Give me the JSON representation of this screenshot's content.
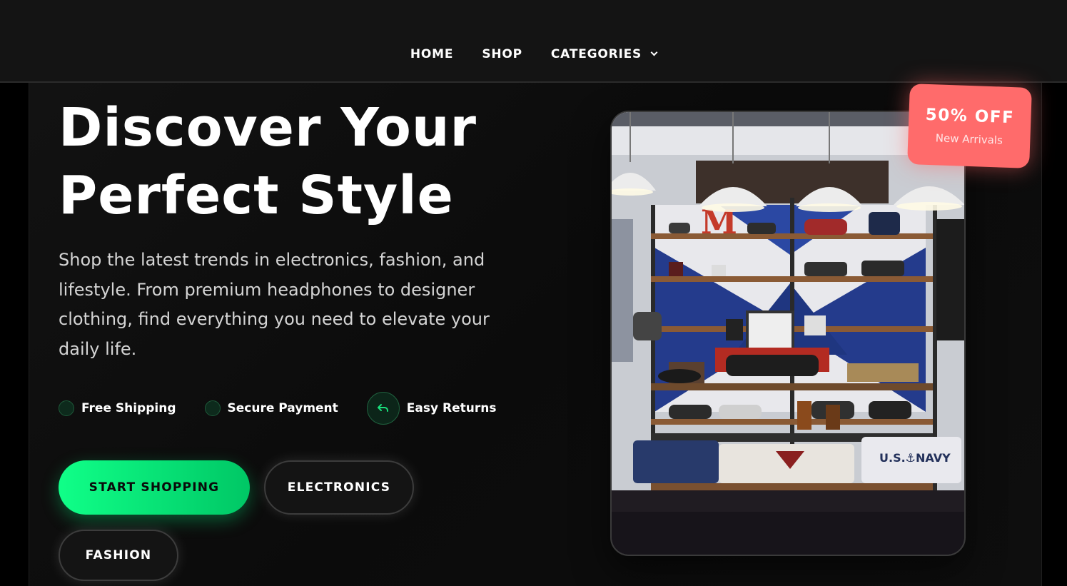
{
  "nav": {
    "items": [
      {
        "label": "HOME"
      },
      {
        "label": "SHOP"
      },
      {
        "label": "CATEGORIES"
      }
    ]
  },
  "hero": {
    "title_line1": "Discover Your",
    "title_line2": "Perfect Style",
    "description": "Shop the latest trends in electronics, fashion, and lifestyle. From premium headphones to designer clothing, find everything you need to elevate your daily life.",
    "features": [
      {
        "label": "Free Shipping",
        "icon": "check-circle-icon"
      },
      {
        "label": "Secure Payment",
        "icon": "shield-circle-icon"
      },
      {
        "label": "Easy Returns",
        "icon": "return-arrow-icon"
      }
    ],
    "buttons": {
      "primary": "START SHOPPING",
      "electronics": "ELECTRONICS",
      "fashion": "FASHION"
    }
  },
  "promo": {
    "title": "50% OFF",
    "subtitle": "New Arrivals"
  },
  "colors": {
    "accent_green": "#10ff88",
    "promo_red": "#ff6b6b",
    "background": "#0b0b0b"
  }
}
